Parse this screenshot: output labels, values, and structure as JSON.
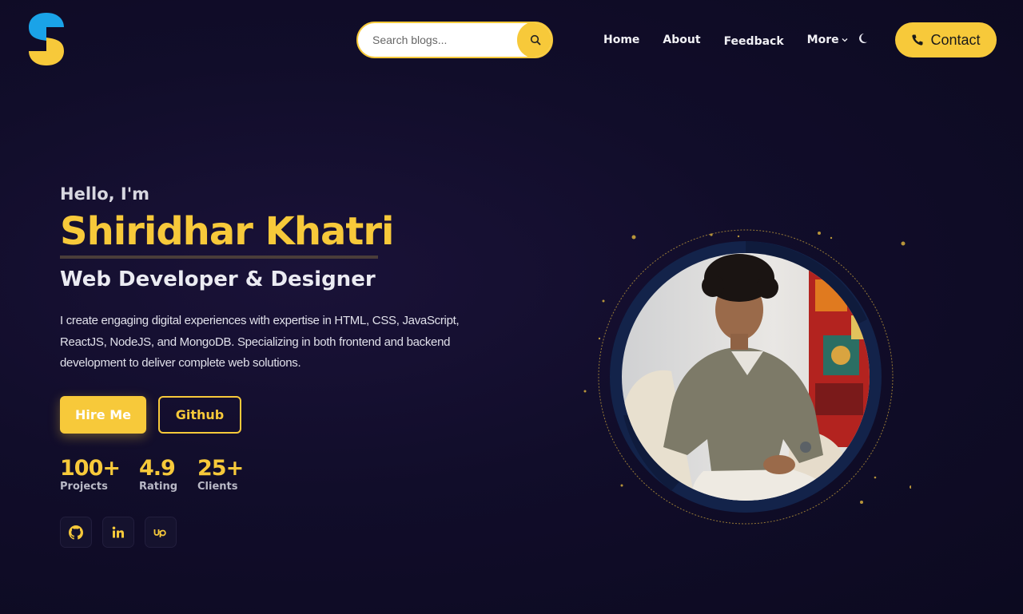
{
  "header": {
    "search": {
      "placeholder": "Search blogs..."
    },
    "nav": [
      {
        "label": "Home"
      },
      {
        "label": "About"
      },
      {
        "label": "Feedback"
      },
      {
        "label": "More"
      }
    ],
    "contact_label": "Contact"
  },
  "hero": {
    "greeting": "Hello, I'm",
    "name": "Shiridhar Khatri",
    "role": "Web Developer & Designer",
    "description": "I create engaging digital experiences with expertise in HTML, CSS, JavaScript, ReactJS, NodeJS, and MongoDB. Specializing in both frontend and backend development to deliver complete web solutions.",
    "hire_label": "Hire Me",
    "github_label": "Github",
    "stats": [
      {
        "value": "100+",
        "label": "Projects"
      },
      {
        "value": "4.9",
        "label": "Rating"
      },
      {
        "value": "25+",
        "label": "Clients"
      }
    ],
    "socials": [
      {
        "icon": "github-icon"
      },
      {
        "icon": "linkedin-icon"
      },
      {
        "icon": "upwork-icon"
      }
    ]
  },
  "colors": {
    "accent": "#f7c93a",
    "background": "#110d2a",
    "logo_blue": "#1aa3e8"
  }
}
